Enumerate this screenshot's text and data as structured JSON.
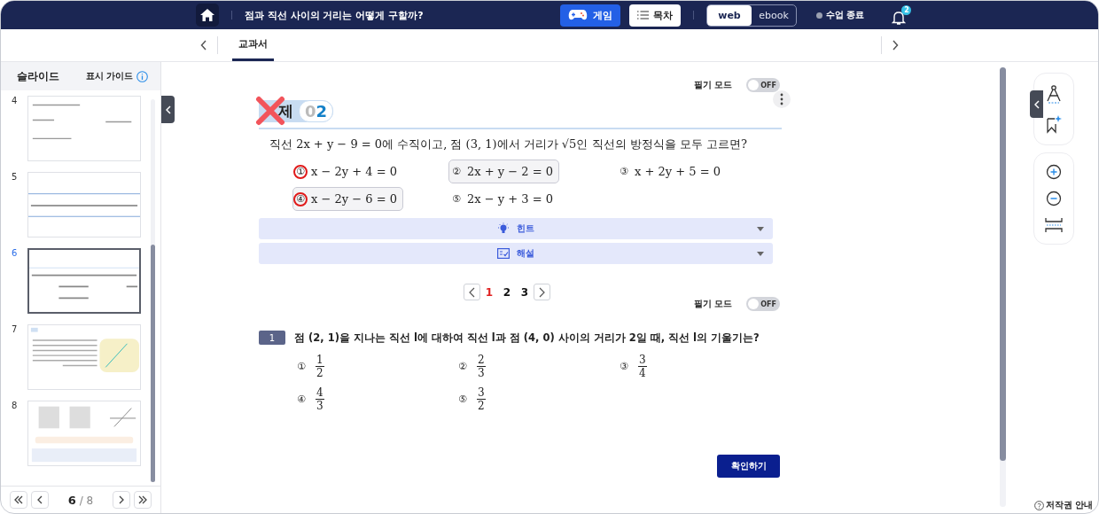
{
  "header": {
    "title": "점과 직선 사이의 거리는 어떻게 구할까?",
    "game_button": "게임",
    "toc_button": "목차",
    "view_tabs": [
      {
        "label": "web",
        "selected": true
      },
      {
        "label": "ebook",
        "selected": false
      }
    ],
    "end_class": "수업 종료",
    "notification_count": "2"
  },
  "tabs": [
    {
      "label": "교과서",
      "selected": true
    }
  ],
  "sidebar": {
    "title": "슬라이드",
    "guide": "표시 가이드",
    "slides": [
      {
        "number": "4",
        "selected": false,
        "kind": "formula"
      },
      {
        "number": "5",
        "selected": false,
        "kind": "text-line"
      },
      {
        "number": "6",
        "selected": true,
        "kind": "question"
      },
      {
        "number": "7",
        "selected": false,
        "kind": "illustration"
      },
      {
        "number": "8",
        "selected": false,
        "kind": "photo"
      }
    ],
    "pager": {
      "current": "6",
      "separator": "/",
      "total": "8"
    }
  },
  "problem": {
    "note_mode": {
      "label": "필기 모드",
      "state": "OFF",
      "on": false
    },
    "label": "제",
    "number_dim": "0",
    "number": "2",
    "question": "직선 2x + y − 9 = 0에 수직이고, 점 (3, 1)에서 거리가 √5인 직선의 방정식을 모두 고르면?",
    "choices": [
      {
        "mark": "①",
        "text": "x − 2y + 4 = 0",
        "marked": true,
        "boxed": false
      },
      {
        "mark": "②",
        "text": "2x + y − 2 = 0",
        "marked": false,
        "boxed": true
      },
      {
        "mark": "③",
        "text": "x + 2y + 5 = 0",
        "marked": false,
        "boxed": false
      },
      {
        "mark": "④",
        "text": "x − 2y − 6 = 0",
        "marked": true,
        "boxed": true
      },
      {
        "mark": "⑤",
        "text": "2x − y + 3 = 0",
        "marked": false,
        "boxed": false
      }
    ],
    "panels": [
      {
        "label": "힌트",
        "kind": "hint",
        "expanded": false
      },
      {
        "label": "해설",
        "kind": "solution",
        "expanded": false
      }
    ]
  },
  "pagination": [
    {
      "label": "1",
      "selected": true
    },
    {
      "label": "2",
      "selected": false
    },
    {
      "label": "3",
      "selected": false
    }
  ],
  "exercise": {
    "note_mode": {
      "label": "필기 모드",
      "state": "OFF",
      "on": false
    },
    "number": "1",
    "question": "점 (2,  1)을 지나는 직선 l에 대하여 직선 l과 점 (4,  0) 사이의 거리가 2일 때, 직선 l의 기울기는?",
    "choices": [
      {
        "mark": "①",
        "numerator": "1",
        "denominator": "2"
      },
      {
        "mark": "②",
        "numerator": "2",
        "denominator": "3"
      },
      {
        "mark": "③",
        "numerator": "3",
        "denominator": "4"
      },
      {
        "mark": "④",
        "numerator": "4",
        "denominator": "3"
      },
      {
        "mark": "⑤",
        "numerator": "3",
        "denominator": "2"
      }
    ],
    "confirm_button": "확인하기"
  },
  "copyright": "저작권 안내"
}
